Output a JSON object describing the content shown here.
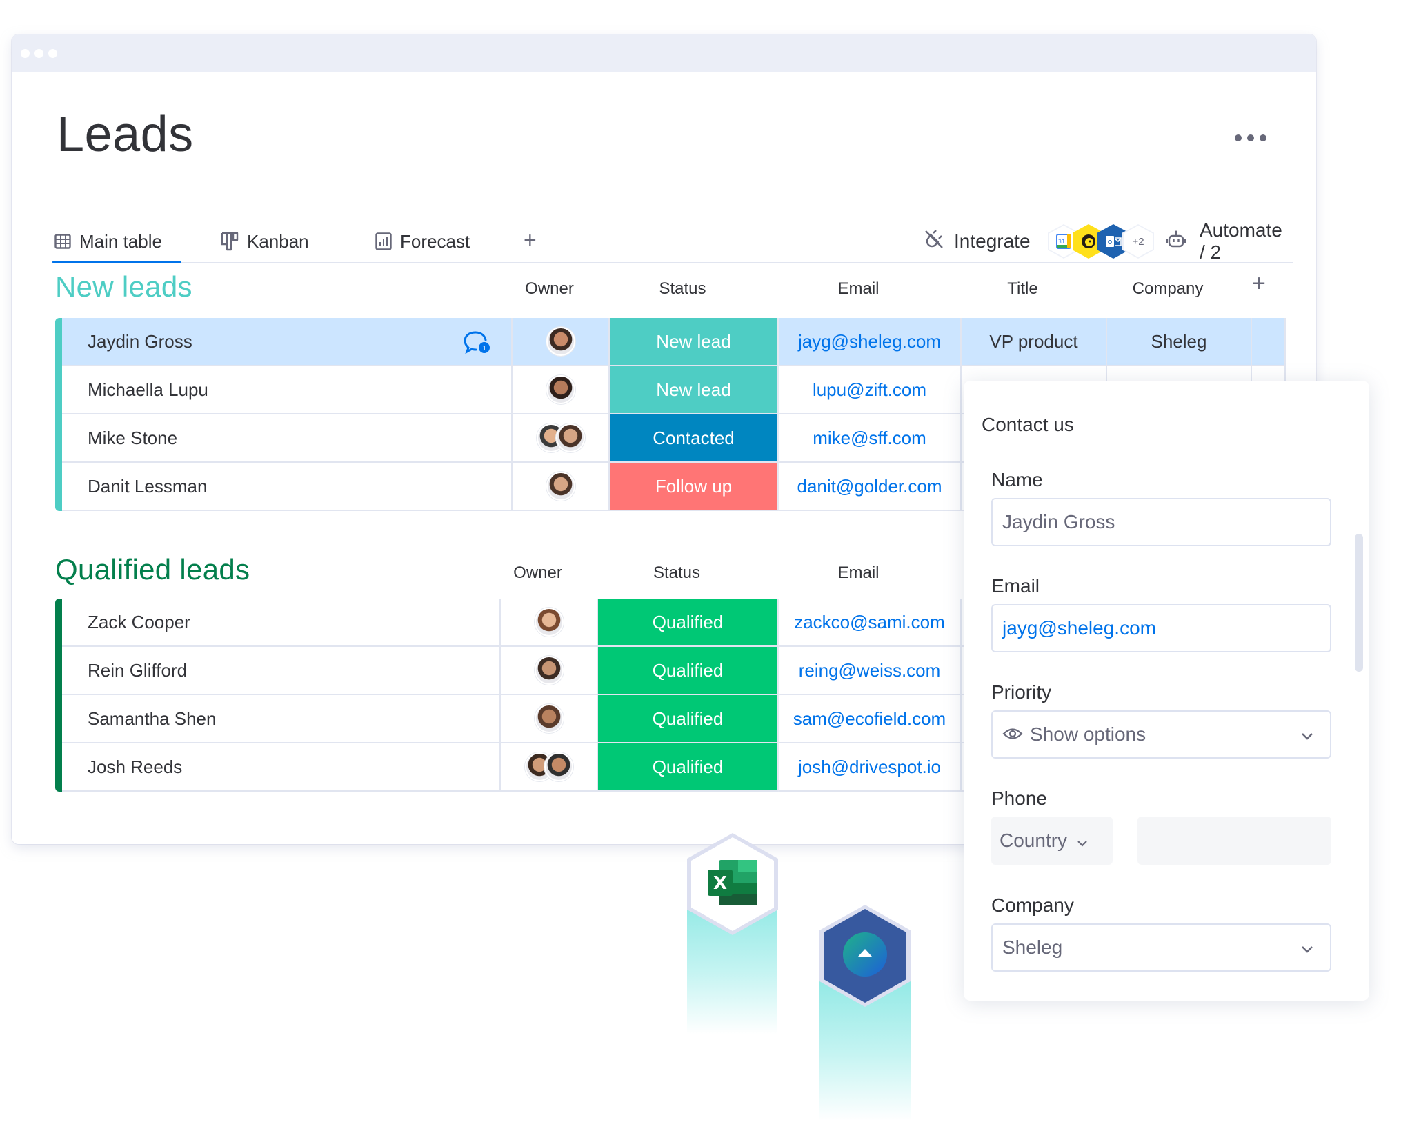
{
  "page": {
    "title": "Leads",
    "more_menu": "more-options"
  },
  "tabs": [
    {
      "label": "Main table",
      "icon": "table-icon",
      "active": true
    },
    {
      "label": "Kanban",
      "icon": "kanban-icon",
      "active": false
    },
    {
      "label": "Forecast",
      "icon": "chart-icon",
      "active": false
    }
  ],
  "toolbar": {
    "add_view": "+",
    "integrate_label": "Integrate",
    "integrations": [
      "google-calendar",
      "mailchimp",
      "outlook"
    ],
    "integrations_more": "+2",
    "automate_label": "Automate / 2"
  },
  "groups": [
    {
      "title": "New leads",
      "color": "#4ecdc4",
      "columns": [
        "Owner",
        "Status",
        "Email",
        "Title",
        "Company"
      ],
      "add_column": "+",
      "rows": [
        {
          "name": "Jaydin Gross",
          "owners": 1,
          "status": "New lead",
          "status_color": "#4ecdc4",
          "email": "jayg@sheleg.com",
          "title": "VP product",
          "company": "Sheleg",
          "highlight": true,
          "updates": "1"
        },
        {
          "name": "Michaella Lupu",
          "owners": 1,
          "status": "New lead",
          "status_color": "#4ecdc4",
          "email": "lupu@zift.com",
          "title": "",
          "company": ""
        },
        {
          "name": "Mike Stone",
          "owners": 2,
          "status": "Contacted",
          "status_color": "#0086c0",
          "email": "mike@sff.com",
          "title": "",
          "company": ""
        },
        {
          "name": "Danit Lessman",
          "owners": 1,
          "status": "Follow up",
          "status_color": "#ff7575",
          "email": "danit@golder.com",
          "title": "",
          "company": ""
        }
      ]
    },
    {
      "title": "Qualified leads",
      "color": "#037f4c",
      "columns": [
        "Owner",
        "Status",
        "Email"
      ],
      "rows": [
        {
          "name": "Zack Cooper",
          "owners": 1,
          "status": "Qualified",
          "status_color": "#00c875",
          "email": "zackco@sami.com"
        },
        {
          "name": "Rein Glifford",
          "owners": 1,
          "status": "Qualified",
          "status_color": "#00c875",
          "email": "reing@weiss.com"
        },
        {
          "name": "Samantha Shen",
          "owners": 1,
          "status": "Qualified",
          "status_color": "#00c875",
          "email": "sam@ecofield.com"
        },
        {
          "name": "Josh Reeds",
          "owners": 2,
          "status": "Qualified",
          "status_color": "#00c875",
          "email": "josh@drivespot.io"
        }
      ]
    }
  ],
  "form": {
    "title": "Contact us",
    "name_label": "Name",
    "name_value": "Jaydin Gross",
    "email_label": "Email",
    "email_value": "jayg@sheleg.com",
    "priority_label": "Priority",
    "priority_placeholder": "Show options",
    "phone_label": "Phone",
    "country_placeholder": "Country",
    "phone_value": "",
    "company_label": "Company",
    "company_value": "Sheleg"
  },
  "floating_integrations": [
    {
      "name": "excel",
      "label": "X"
    },
    {
      "name": "dynamics"
    }
  ],
  "colors": {
    "accent": "#0073ea",
    "new_lead": "#4ecdc4",
    "contacted": "#0086c0",
    "follow_up": "#ff7575",
    "qualified": "#00c875",
    "highlight_row": "#cce5ff"
  }
}
